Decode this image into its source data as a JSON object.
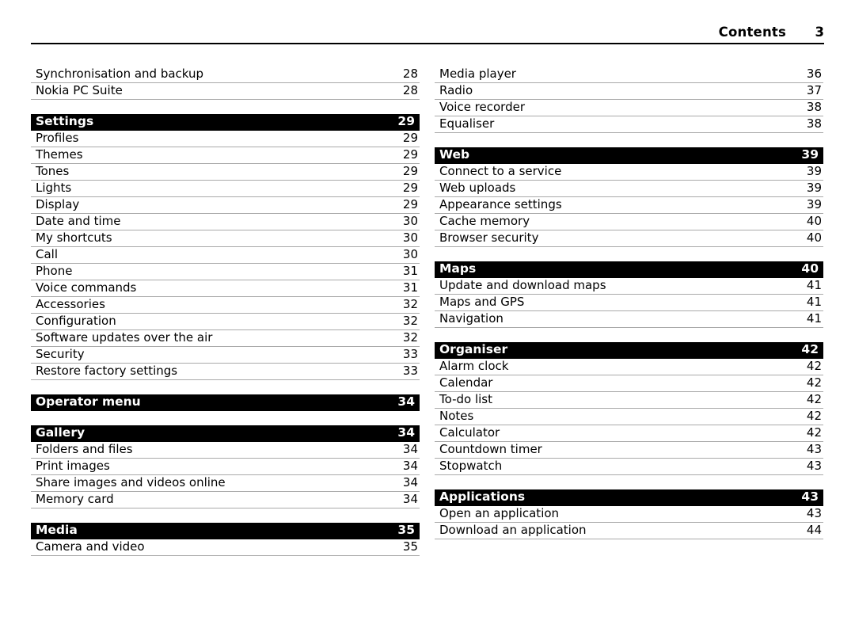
{
  "header": {
    "title": "Contents",
    "page_number": "3"
  },
  "columns": {
    "left": [
      {
        "kind": "entry",
        "label": "Synchronisation and backup",
        "page": "28"
      },
      {
        "kind": "entry",
        "label": "Nokia PC Suite",
        "page": "28"
      },
      {
        "kind": "gap"
      },
      {
        "kind": "section",
        "label": "Settings",
        "page": "29"
      },
      {
        "kind": "entry",
        "label": "Profiles",
        "page": "29"
      },
      {
        "kind": "entry",
        "label": "Themes",
        "page": "29"
      },
      {
        "kind": "entry",
        "label": "Tones",
        "page": "29"
      },
      {
        "kind": "entry",
        "label": "Lights",
        "page": "29"
      },
      {
        "kind": "entry",
        "label": "Display",
        "page": "29"
      },
      {
        "kind": "entry",
        "label": "Date and time",
        "page": "30"
      },
      {
        "kind": "entry",
        "label": "My shortcuts",
        "page": "30"
      },
      {
        "kind": "entry",
        "label": "Call",
        "page": "30"
      },
      {
        "kind": "entry",
        "label": "Phone",
        "page": "31"
      },
      {
        "kind": "entry",
        "label": "Voice commands",
        "page": "31"
      },
      {
        "kind": "entry",
        "label": "Accessories",
        "page": "32"
      },
      {
        "kind": "entry",
        "label": "Configuration",
        "page": "32"
      },
      {
        "kind": "entry",
        "label": "Software updates over the air",
        "page": "32"
      },
      {
        "kind": "entry",
        "label": "Security",
        "page": "33"
      },
      {
        "kind": "entry",
        "label": "Restore factory settings",
        "page": "33"
      },
      {
        "kind": "gap"
      },
      {
        "kind": "section",
        "label": "Operator menu",
        "page": "34"
      },
      {
        "kind": "gap"
      },
      {
        "kind": "section",
        "label": "Gallery",
        "page": "34"
      },
      {
        "kind": "entry",
        "label": "Folders and files",
        "page": "34"
      },
      {
        "kind": "entry",
        "label": "Print images",
        "page": "34"
      },
      {
        "kind": "entry",
        "label": "Share images and videos online",
        "page": "34"
      },
      {
        "kind": "entry",
        "label": "Memory card",
        "page": "34"
      },
      {
        "kind": "gap"
      },
      {
        "kind": "section",
        "label": "Media",
        "page": "35"
      },
      {
        "kind": "entry",
        "label": "Camera and video",
        "page": "35"
      }
    ],
    "right": [
      {
        "kind": "entry",
        "label": "Media player",
        "page": "36"
      },
      {
        "kind": "entry",
        "label": "Radio",
        "page": "37"
      },
      {
        "kind": "entry",
        "label": "Voice recorder",
        "page": "38"
      },
      {
        "kind": "entry",
        "label": "Equaliser",
        "page": "38"
      },
      {
        "kind": "gap"
      },
      {
        "kind": "section",
        "label": "Web",
        "page": "39"
      },
      {
        "kind": "entry",
        "label": "Connect to a service",
        "page": "39"
      },
      {
        "kind": "entry",
        "label": "Web uploads",
        "page": "39"
      },
      {
        "kind": "entry",
        "label": "Appearance settings",
        "page": "39"
      },
      {
        "kind": "entry",
        "label": "Cache memory",
        "page": "40"
      },
      {
        "kind": "entry",
        "label": "Browser security",
        "page": "40"
      },
      {
        "kind": "gap"
      },
      {
        "kind": "section",
        "label": "Maps",
        "page": "40"
      },
      {
        "kind": "entry",
        "label": "Update and download maps",
        "page": "41"
      },
      {
        "kind": "entry",
        "label": "Maps and GPS",
        "page": "41"
      },
      {
        "kind": "entry",
        "label": "Navigation",
        "page": "41"
      },
      {
        "kind": "gap"
      },
      {
        "kind": "section",
        "label": "Organiser",
        "page": "42"
      },
      {
        "kind": "entry",
        "label": "Alarm clock",
        "page": "42"
      },
      {
        "kind": "entry",
        "label": "Calendar",
        "page": "42"
      },
      {
        "kind": "entry",
        "label": "To-do list",
        "page": "42"
      },
      {
        "kind": "entry",
        "label": "Notes",
        "page": "42"
      },
      {
        "kind": "entry",
        "label": "Calculator",
        "page": "42"
      },
      {
        "kind": "entry",
        "label": "Countdown timer",
        "page": "43"
      },
      {
        "kind": "entry",
        "label": "Stopwatch",
        "page": "43"
      },
      {
        "kind": "gap"
      },
      {
        "kind": "section",
        "label": "Applications",
        "page": "43"
      },
      {
        "kind": "entry",
        "label": "Open an application",
        "page": "43"
      },
      {
        "kind": "entry",
        "label": "Download an application",
        "page": "44"
      }
    ]
  }
}
